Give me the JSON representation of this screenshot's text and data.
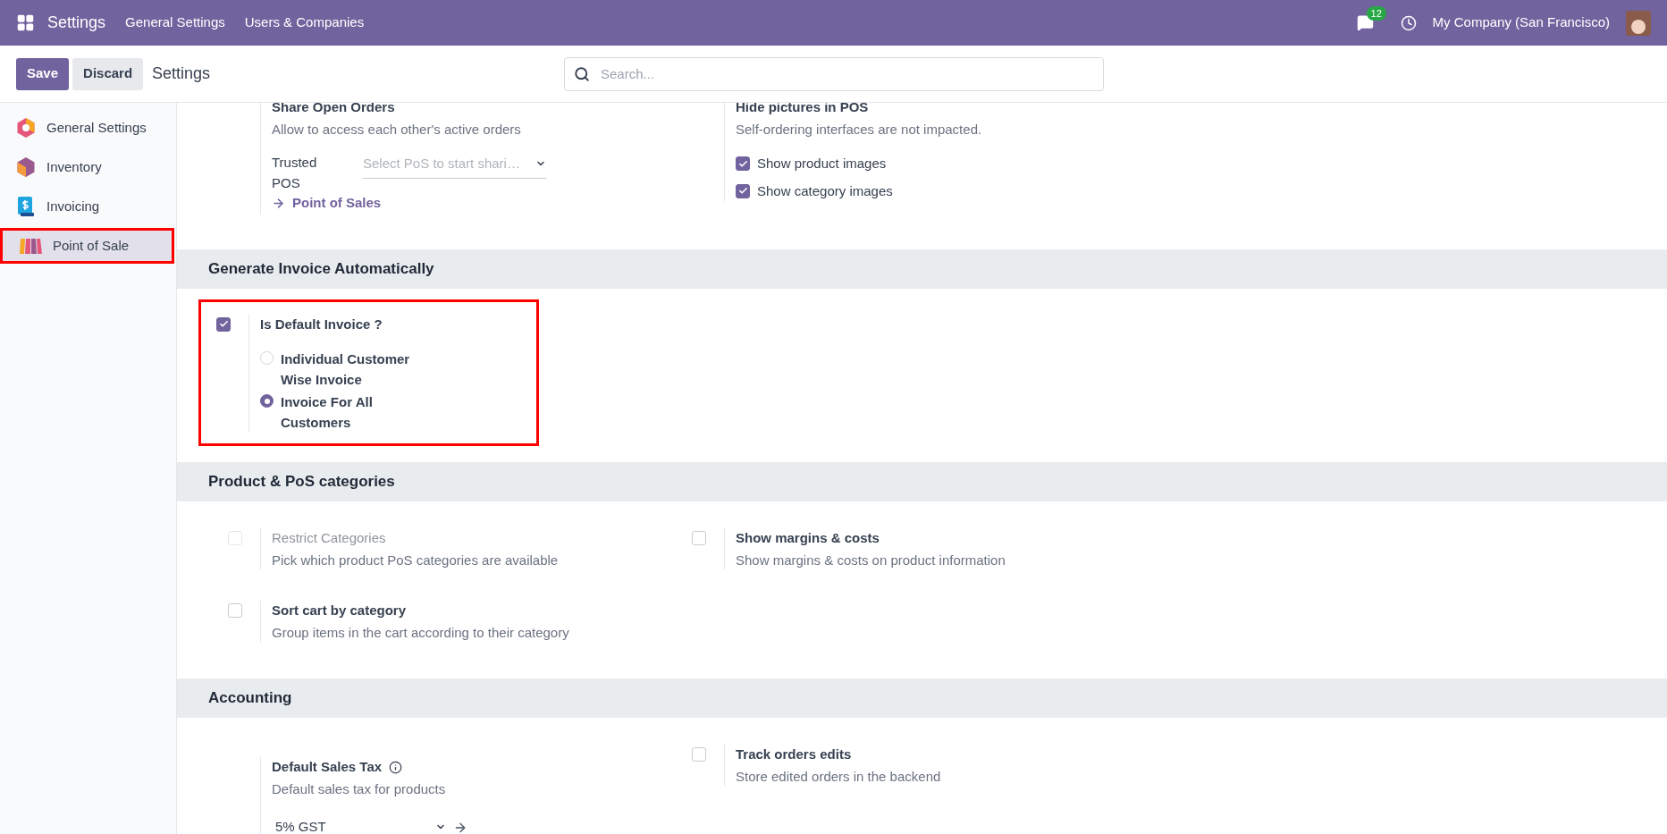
{
  "navbar": {
    "app_title": "Settings",
    "menu": [
      "General Settings",
      "Users & Companies"
    ],
    "message_count": "12",
    "company": "My Company (San Francisco)"
  },
  "control_panel": {
    "buttons": [
      {
        "label": "Save",
        "kind": "primary"
      },
      {
        "label": "Discard",
        "kind": "secondary"
      }
    ],
    "breadcrumb": "Settings",
    "search": {
      "placeholder": "Search..."
    }
  },
  "sidebar": {
    "items": [
      {
        "label": "General Settings",
        "selected": false,
        "highlighted": false
      },
      {
        "label": "Inventory",
        "selected": false,
        "highlighted": false
      },
      {
        "label": "Invoicing",
        "selected": false,
        "highlighted": false
      },
      {
        "label": "Point of Sale",
        "selected": true,
        "highlighted": true
      }
    ]
  },
  "sections": [
    {
      "settings": [
        {
          "kind": "field",
          "title": "Share Open Orders",
          "description": "Allow to access each other's active orders",
          "field_label": "Trusted POS",
          "placeholder": "Select PoS to start shari…",
          "link": "Point of Sales"
        },
        {
          "kind": "options",
          "title": "Hide pictures in POS",
          "description": "Self-ordering interfaces are not impacted.",
          "options": [
            {
              "label": "Show product images",
              "checked": true
            },
            {
              "label": "Show category images",
              "checked": true
            }
          ]
        }
      ]
    },
    {
      "title": "Generate Invoice Automatically",
      "settings": [
        {
          "kind": "checkbox",
          "title": "Is Default Invoice ?",
          "checked": true,
          "disabled": false,
          "highlighted": true,
          "radios": [
            {
              "label": "Individual Customer Wise Invoice",
              "selected": false
            },
            {
              "label": "Invoice For All Customers",
              "selected": true
            }
          ]
        }
      ]
    },
    {
      "title": "Product & PoS categories",
      "settings": [
        {
          "kind": "checkbox",
          "title": "Restrict Categories",
          "description": "Pick which product PoS categories are available",
          "checked": false,
          "disabled": true
        },
        {
          "kind": "checkbox",
          "title": "Show margins & costs",
          "description": "Show margins & costs on product information",
          "checked": false,
          "disabled": false
        },
        {
          "kind": "checkbox",
          "title": "Sort cart by category",
          "description": "Group items in the cart according to their category",
          "checked": false,
          "disabled": false
        }
      ]
    },
    {
      "title": "Accounting",
      "settings": [
        {
          "kind": "select",
          "title": "Default Sales Tax",
          "description": "Default sales tax for products",
          "value": "5% GST"
        },
        {
          "kind": "checkbox",
          "title": "Track orders edits",
          "description": "Store edited orders in the backend",
          "checked": false,
          "disabled": false
        }
      ]
    }
  ]
}
